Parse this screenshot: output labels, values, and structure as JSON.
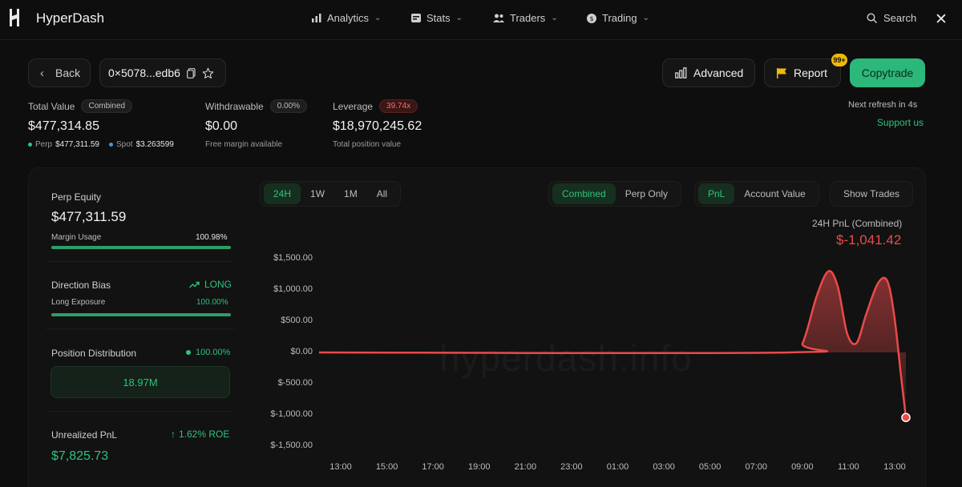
{
  "nav": {
    "brand": "HyperDash",
    "items": [
      {
        "label": "Analytics",
        "icon": "bar-chart-icon"
      },
      {
        "label": "Stats",
        "icon": "stats-card-icon"
      },
      {
        "label": "Traders",
        "icon": "users-icon"
      },
      {
        "label": "Trading",
        "icon": "coin-icon"
      }
    ],
    "search_label": "Search"
  },
  "topbar": {
    "back_label": "Back",
    "address": "0×5078...edb6",
    "advanced_label": "Advanced",
    "report_label": "Report",
    "report_badge": "99+",
    "copytrade_label": "Copytrade",
    "refresh_text": "Next refresh in 4s",
    "support_label": "Support us"
  },
  "stats": {
    "total_value": {
      "label": "Total Value",
      "tag": "Combined",
      "value": "$477,314.85",
      "perp_label": "Perp",
      "perp_value": "$477,311.59",
      "spot_label": "Spot",
      "spot_value": "$3.263599"
    },
    "withdrawable": {
      "label": "Withdrawable",
      "tag": "0.00%",
      "value": "$0.00",
      "sub": "Free margin available"
    },
    "leverage": {
      "label": "Leverage",
      "tag": "39.74x",
      "value": "$18,970,245.62",
      "sub": "Total position value"
    }
  },
  "left_panel": {
    "perp_equity_label": "Perp Equity",
    "perp_equity_value": "$477,311.59",
    "margin_usage_label": "Margin Usage",
    "margin_usage_value": "100.98%",
    "margin_usage_fraction": 1.0,
    "direction_bias_label": "Direction Bias",
    "direction_bias_value": "LONG",
    "long_exposure_label": "Long Exposure",
    "long_exposure_value": "100.00%",
    "long_exposure_fraction": 1.0,
    "position_distribution_label": "Position Distribution",
    "position_distribution_value": "100.00%",
    "position_distribution_box": "18.97M",
    "unrealized_pnl_label": "Unrealized PnL",
    "roe_value": "1.62% ROE",
    "unrealized_pnl_value": "$7,825.73"
  },
  "controls": {
    "timeframes": [
      "24H",
      "1W",
      "1M",
      "All"
    ],
    "active_timeframe": "24H",
    "modes": [
      "Combined",
      "Perp Only"
    ],
    "active_mode": "Combined",
    "metrics": [
      "PnL",
      "Account Value"
    ],
    "active_metric": "PnL",
    "show_trades_label": "Show Trades"
  },
  "pnl_caption": "24H PnL (Combined)",
  "pnl_value": "$-1,041.42",
  "watermark": "hyperdash.info",
  "colors": {
    "accent": "#2ec27e",
    "negative": "#e84b4b",
    "copytrade": "#2bb87a"
  },
  "chart_data": {
    "type": "area",
    "x": [
      "13:00",
      "15:00",
      "17:00",
      "19:00",
      "21:00",
      "23:00",
      "01:00",
      "03:00",
      "05:00",
      "07:00",
      "09:00",
      "11:00",
      "13:00"
    ],
    "y_ticks": [
      "$1,500.00",
      "$1,000.00",
      "$500.00",
      "$0.00",
      "$-500.00",
      "$-1,000.00",
      "$-1,500.00"
    ],
    "ylim": [
      -1500,
      1500
    ],
    "grid": false,
    "series": [
      {
        "points": [
          [
            0,
            0
          ],
          [
            10,
            0
          ],
          [
            10.3,
            150
          ],
          [
            10.6,
            900
          ],
          [
            10.85,
            1300
          ],
          [
            11.05,
            1050
          ],
          [
            11.25,
            300
          ],
          [
            11.45,
            150
          ],
          [
            11.65,
            600
          ],
          [
            11.9,
            1100
          ],
          [
            12.1,
            1150
          ],
          [
            12.25,
            600
          ],
          [
            12.4,
            -400
          ],
          [
            12.5,
            -1041.42
          ]
        ]
      }
    ]
  }
}
